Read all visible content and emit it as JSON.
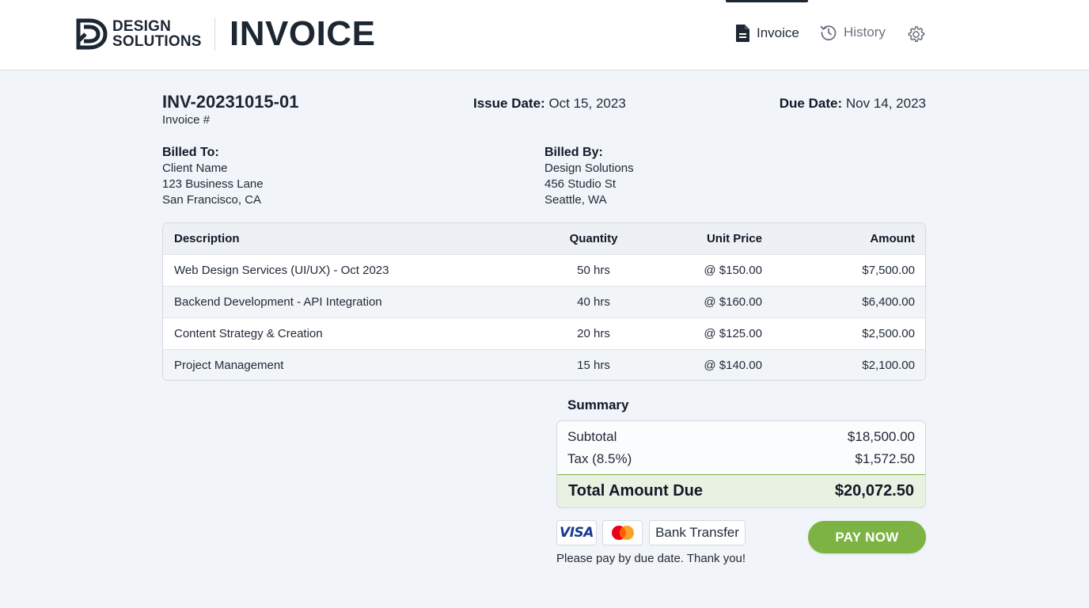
{
  "brand": {
    "logo_line1": "DESIGN",
    "logo_line2": "SOLUTIONS",
    "page_title": "INVOICE"
  },
  "nav": {
    "invoice_label": "Invoice",
    "history_label": "History",
    "active": "invoice"
  },
  "invoice": {
    "number": "INV-20231015-01",
    "number_label": "Invoice #",
    "issue_date_label": "Issue Date:",
    "issue_date": "Oct 15, 2023",
    "due_date_label": "Due Date:",
    "due_date": "Nov 14, 2023"
  },
  "billed_to": {
    "title": "Billed To:",
    "name": "Client Name",
    "street": "123 Business Lane",
    "city": "San Francisco, CA"
  },
  "billed_by": {
    "title": "Billed By:",
    "name": "Design Solutions",
    "street": "456 Studio St",
    "city": "Seattle, WA"
  },
  "table": {
    "headers": {
      "description": "Description",
      "quantity": "Quantity",
      "unit_price": "Unit Price",
      "amount": "Amount"
    },
    "rows": [
      {
        "description": "Web Design Services (UI/UX) - Oct 2023",
        "quantity": "50 hrs",
        "unit_price": "@ $150.00",
        "amount": "$7,500.00"
      },
      {
        "description": "Backend Development - API Integration",
        "quantity": "40 hrs",
        "unit_price": "@ $160.00",
        "amount": "$6,400.00"
      },
      {
        "description": "Content Strategy & Creation",
        "quantity": "20 hrs",
        "unit_price": "@ $125.00",
        "amount": "$2,500.00"
      },
      {
        "description": "Project Management",
        "quantity": "15 hrs",
        "unit_price": "@ $140.00",
        "amount": "$2,100.00"
      }
    ]
  },
  "summary": {
    "title": "Summary",
    "subtotal_label": "Subtotal",
    "subtotal": "$18,500.00",
    "tax_label": "Tax (8.5%)",
    "tax": "$1,572.50",
    "total_label": "Total Amount Due",
    "total": "$20,072.50"
  },
  "payment": {
    "visa_label": "VISA",
    "bank_label": "Bank Transfer",
    "note": "Please pay by due date. Thank you!",
    "pay_button": "PAY NOW"
  },
  "colors": {
    "brand_dark": "#1c2733",
    "accent_green": "#7cb342",
    "total_bg": "#e9f2e2",
    "page_bg": "#f1f4f8"
  },
  "icons": {
    "invoice_nav": "document-icon",
    "history_nav": "history-icon",
    "settings": "gear-icon",
    "mastercard": "mastercard-icon",
    "logo": "ds-logo-mark"
  }
}
